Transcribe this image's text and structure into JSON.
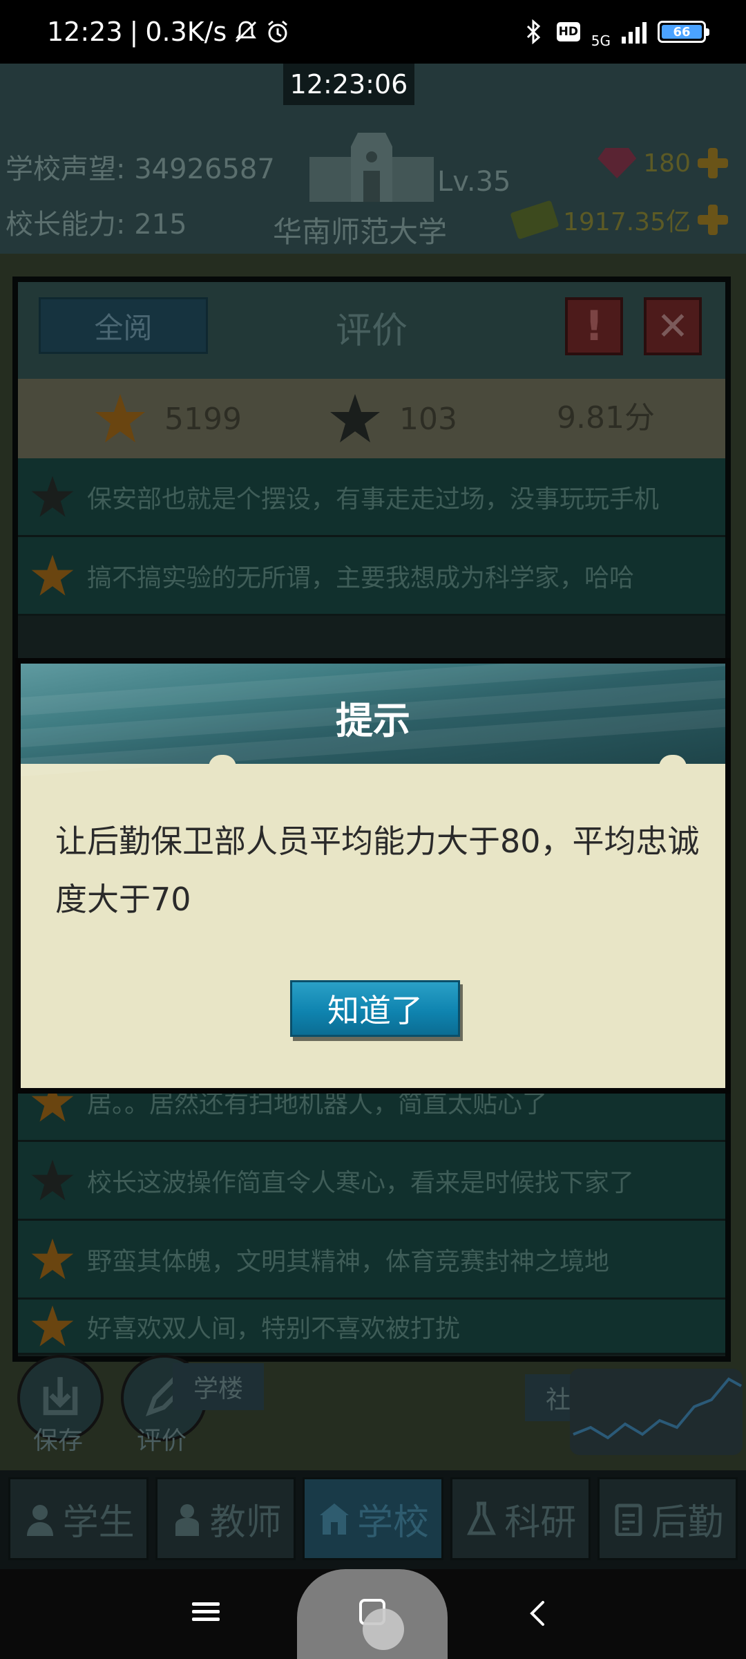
{
  "status_bar": {
    "time": "12:23",
    "separator": "|",
    "net_speed": "0.3K/s",
    "network": "5G",
    "hd_badge": "HD",
    "battery": "66"
  },
  "game": {
    "clock": "12:23:06",
    "reputation_label": "学校声望:",
    "reputation_value": "34926587",
    "ability_label": "校长能力:",
    "ability_value": "215",
    "school_name": "华南师范大学",
    "level": "Lv.35",
    "gems": "180",
    "money": "1917.35亿"
  },
  "rating_panel": {
    "read_all_label": "全阅",
    "title": "评价",
    "warn_label": "!",
    "close_label": "✕",
    "good_count": "5199",
    "bad_count": "103",
    "score": "9.81分",
    "comments": [
      {
        "text": "保安部也就是个摆设，有事走走过场，没事玩玩手机",
        "sentiment": "bad"
      },
      {
        "text": "搞不搞实验的无所谓，主要我想成为科学家，哈哈",
        "sentiment": "good"
      },
      {
        "text": "居。。居然还有扫地机器人，简直太贴心了",
        "sentiment": "good"
      },
      {
        "text": "校长这波操作简直令人寒心，看来是时候找下家了",
        "sentiment": "bad"
      },
      {
        "text": "野蛮其体魄，文明其精神，体育竞赛封神之境地",
        "sentiment": "good"
      },
      {
        "text": "好喜欢双人间，特别不喜欢被打扰",
        "sentiment": "good"
      }
    ]
  },
  "hud": {
    "save_label": "保存",
    "review_label": "评价",
    "teaching_building_label": "学楼",
    "club_label": "社团"
  },
  "nav_tabs": [
    {
      "label": "学生",
      "icon": "student-icon",
      "active": false
    },
    {
      "label": "教师",
      "icon": "teacher-icon",
      "active": false
    },
    {
      "label": "学校",
      "icon": "school-icon",
      "active": true
    },
    {
      "label": "科研",
      "icon": "research-icon",
      "active": false
    },
    {
      "label": "后勤",
      "icon": "logistics-icon",
      "active": false
    }
  ],
  "dialog": {
    "title": "提示",
    "message": "让后勤保卫部人员平均能力大于80，平均忠诚度大于70",
    "ok_label": "知道了"
  },
  "colors": {
    "dialog_bg": "#e8e5c6",
    "dialog_button": "#1a8fb9",
    "star_good": "#d88a10",
    "star_bad": "#1e2626"
  }
}
